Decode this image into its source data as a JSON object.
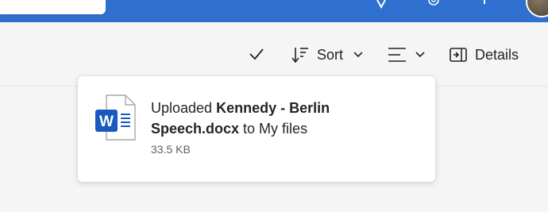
{
  "toolbar": {
    "sort_label": "Sort",
    "details_label": "Details"
  },
  "toast": {
    "prefix": "Uploaded ",
    "file_name": "Kennedy - Berlin Speech.docx",
    "suffix": " to My files",
    "file_size": "33.5 KB",
    "file_icon_letter": "W"
  },
  "colors": {
    "topbar": "#2f6fcf",
    "word_blue": "#185abd"
  }
}
